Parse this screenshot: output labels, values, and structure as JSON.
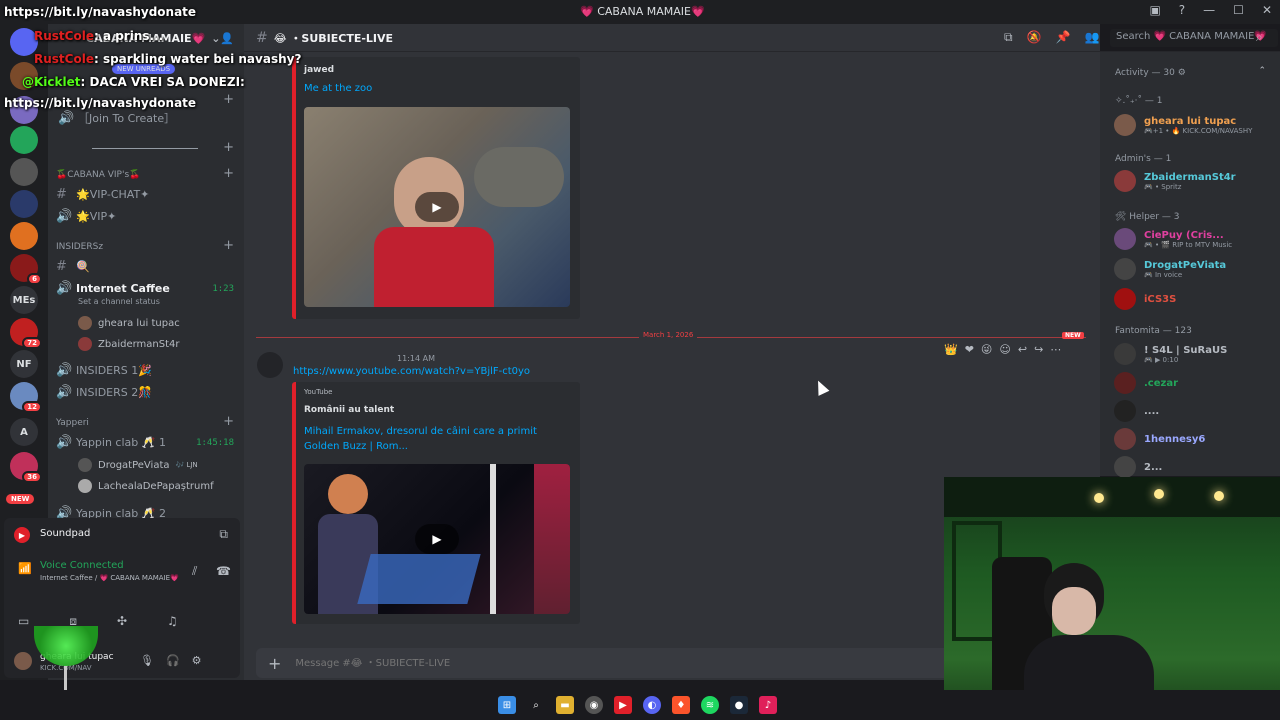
{
  "stream_overlay": {
    "donate_url_top": "https://bit.ly/navashydonate",
    "chat": [
      {
        "user": "RustCole",
        "text": ": a prins..."
      },
      {
        "user": "RustCole",
        "text": ": sparkling water bei navashy?"
      },
      {
        "user": "@Kicklet",
        "text": ": DACA VREI SA DONEZI:"
      }
    ],
    "donate_url_bottom": "https://bit.ly/navashydonate"
  },
  "titlebar": {
    "server_title": "💗 CABANA MAMAIE💗"
  },
  "server_rail": {
    "items": [
      {
        "label": "",
        "color": "#5865f2"
      },
      {
        "label": "",
        "color": "#7a4a2a"
      },
      {
        "label": "",
        "color": "#23a55a",
        "badge": ""
      },
      {
        "label": "",
        "color": "#555"
      },
      {
        "label": "",
        "color": "#2a3a6a"
      },
      {
        "label": "",
        "color": "#e07020"
      },
      {
        "label": "",
        "color": "#8a1a1a",
        "badge": "6"
      },
      {
        "label": "MEs",
        "color": "#313338"
      },
      {
        "label": "",
        "color": "#c02020",
        "badge": "72"
      },
      {
        "label": "NF",
        "color": "#313338"
      },
      {
        "label": "",
        "color": "#6a8ac0",
        "badge": "12"
      },
      {
        "label": "A",
        "color": "#313338"
      },
      {
        "label": "",
        "color": "#c0305a",
        "badge": "36"
      }
    ],
    "new_label": "NEW"
  },
  "sidebar": {
    "server_name": "CABANA MAMAIE💗",
    "new_unreads": "NEW UNREADS",
    "join_to_create": "［Join To Create］",
    "categories": {
      "vip": "🍒CABANA VIP's🍒",
      "insiders": "INSIDERSz",
      "yapperi": "Yapperi"
    },
    "channels": {
      "vip_chat": "🌟VIP-CHAT✦",
      "vip": "🌟VIP✦",
      "insiders_text": "🍭",
      "internet_caffee": "Internet Caffee",
      "internet_caffee_status": "Set a channel status",
      "internet_caffee_timer": "1:23",
      "insiders1": "INSIDERS 1🎉",
      "insiders2": "INSIDERS 2🎊",
      "yappin_clab": "Yappin clab 🥂 1",
      "yappin_timer": "1:45:18",
      "yappin_clab2": "Yappin clab 🥂 2"
    },
    "voice_users_caffee": [
      "gheara lui tupac",
      "ZbaidermanSt4r"
    ],
    "voice_users_yappin": [
      {
        "name": "DrogatPeViata",
        "tag": "🎶 LJN"
      },
      {
        "name": "LachealaDePapaștrumf",
        "tag": ""
      }
    ]
  },
  "soundpad": {
    "title": "Soundpad",
    "voice_status": "Voice Connected",
    "voice_channel": "Internet Caffee / 💗 CABANA MAMAIE💗",
    "user_name": "gheara lui tupac",
    "user_status": "KICK.COM/NAV"
  },
  "channel": {
    "name": "😂 ・SUBIECTE-LIVE",
    "search_placeholder": "Search 💗 CABANA MAMAIE💗",
    "composer_placeholder": "Message #😂 ・SUBIECTE-LIVE"
  },
  "messages": {
    "embed1": {
      "author": "jawed",
      "title": "Me at the zoo"
    },
    "divider_date": "March 1, 2026",
    "divider_new": "NEW",
    "message2": {
      "author": "",
      "time": "11:14 AM",
      "link": "https://www.youtube.com/watch?v=YBjlF-ct0yo"
    },
    "embed2": {
      "provider": "YouTube",
      "author": "Românii au talent",
      "title": "Mihail Ermakov, dresorul de câini care a primit Golden Buzz | Rom..."
    }
  },
  "members": {
    "activity": "Activity — 30 ⚙",
    "groups": [
      {
        "label": "✧.˚₊·˚ — 1"
      },
      {
        "label": "Admin's — 1"
      },
      {
        "label": "🛠 Helper — 3"
      },
      {
        "label": "Fantomita — 123"
      }
    ],
    "list": [
      {
        "name": "gheara lui tupac",
        "status": "🎮+1 • 🔥 KICK.COM/NAVASHY",
        "color": "#f0a050"
      },
      {
        "name": "ZbaidermanSt4r",
        "status": "🎮 • Spritz",
        "color": "#56c9d9"
      },
      {
        "name": "CiePuy (Cris...",
        "status": "🎮 • 🎬 RIP to MTV Music",
        "color": "#e040a0"
      },
      {
        "name": "DrogatPeViata",
        "status": "🎮 In voice",
        "color": "#56c9d9"
      },
      {
        "name": "iCS3S",
        "status": "",
        "color": "#e05040"
      },
      {
        "name": "! S4L | SuRaUS",
        "status": "🎮 ▶ 0:10",
        "color": "#b5bac1"
      },
      {
        "name": ".cezar",
        "status": "",
        "color": "#23a55a"
      },
      {
        "name": "....",
        "status": "",
        "color": "#b5bac1"
      },
      {
        "name": "1hennesy6",
        "status": "",
        "color": "#9aa8ff"
      },
      {
        "name": "2...",
        "status": "",
        "color": "#b5bac1"
      }
    ]
  }
}
